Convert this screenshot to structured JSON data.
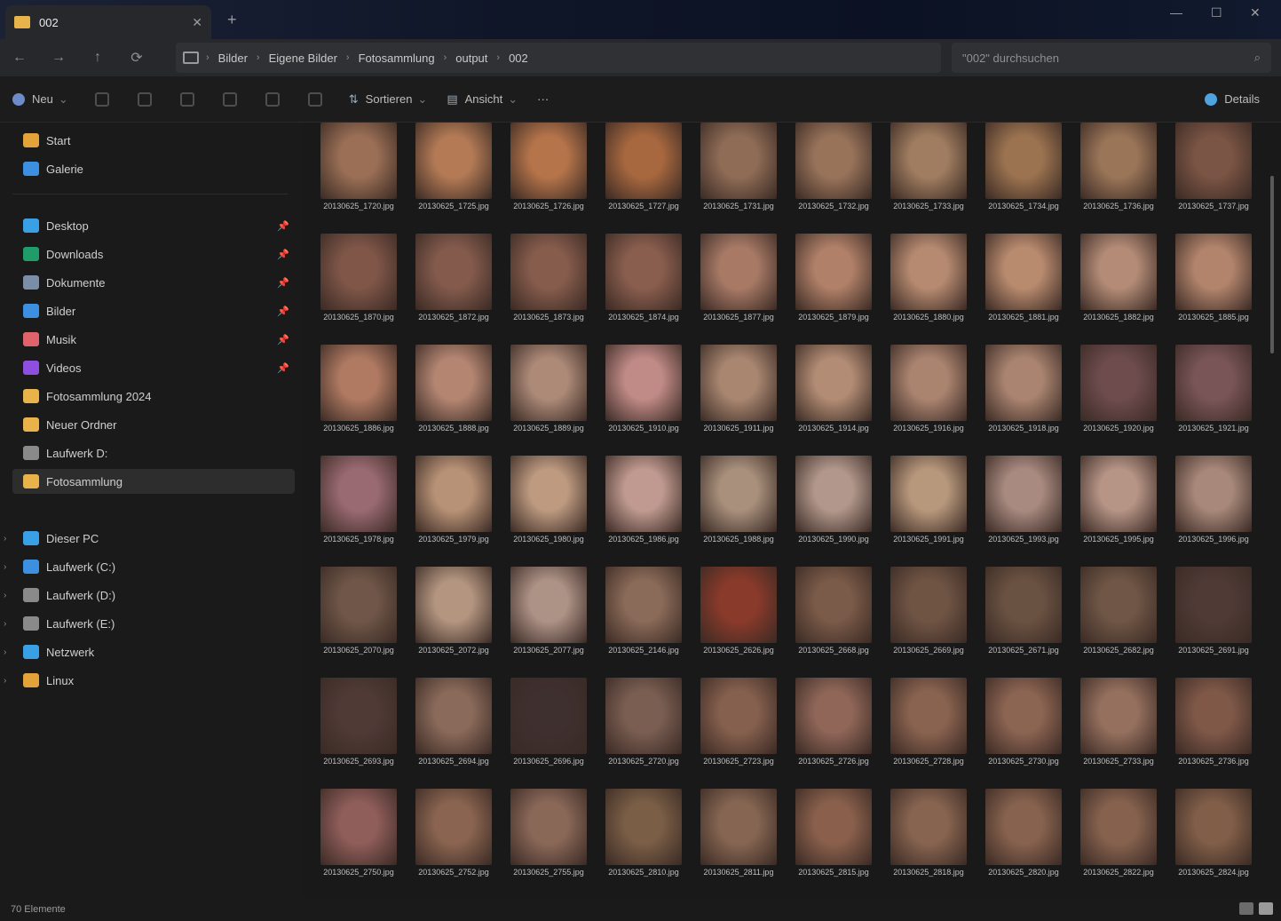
{
  "window": {
    "tab_title": "002"
  },
  "address": {
    "crumbs": [
      "Bilder",
      "Eigene Bilder",
      "Fotosammlung",
      "output",
      "002"
    ],
    "search_placeholder": "\"002\" durchsuchen"
  },
  "toolbar": {
    "new_label": "Neu",
    "sort_label": "Sortieren",
    "view_label": "Ansicht",
    "more_label": "···",
    "details_label": "Details"
  },
  "sidebar": {
    "quick": [
      {
        "label": "Start",
        "color": "#e3a33a"
      },
      {
        "label": "Galerie",
        "color": "#3d8fe0"
      }
    ],
    "pinned": [
      {
        "label": "Desktop",
        "color": "#3aa0e6"
      },
      {
        "label": "Downloads",
        "color": "#1f9c6a"
      },
      {
        "label": "Dokumente",
        "color": "#7a8ea8"
      },
      {
        "label": "Bilder",
        "color": "#3d8fe0"
      },
      {
        "label": "Musik",
        "color": "#e0636b"
      },
      {
        "label": "Videos",
        "color": "#8e4fe0"
      },
      {
        "label": "Fotosammlung 2024",
        "color": "#e8b34a"
      },
      {
        "label": "Neuer Ordner",
        "color": "#e8b34a"
      },
      {
        "label": "Laufwerk D:",
        "color": "#8a8a8a"
      },
      {
        "label": "Fotosammlung",
        "color": "#e8b34a"
      }
    ],
    "tree": [
      {
        "label": "Dieser PC",
        "color": "#3aa0e6"
      },
      {
        "label": "Laufwerk (C:)",
        "color": "#3d8fe0"
      },
      {
        "label": "Laufwerk (D:)",
        "color": "#8a8a8a"
      },
      {
        "label": "Laufwerk (E:)",
        "color": "#8a8a8a"
      },
      {
        "label": "Netzwerk",
        "color": "#3aa0e6"
      },
      {
        "label": "Linux",
        "color": "#e3a33a"
      }
    ]
  },
  "files": {
    "rows": [
      [
        "#9a6f55",
        "#b37a55",
        "#b5744a",
        "#a8683f",
        "#8f6c56",
        "#98735a",
        "#a07d60",
        "#9c7350",
        "#9a7558",
        "#7a5444"
      ],
      [
        "#7f5648",
        "#835a4c",
        "#865c4c",
        "#8a5e4e",
        "#a87a66",
        "#b08068",
        "#b68a70",
        "#b88a6e",
        "#b38b76",
        "#b2846c"
      ],
      [
        "#b07a62",
        "#b48672",
        "#ad8a78",
        "#c08a86",
        "#a88670",
        "#b28c74",
        "#ab8470",
        "#aa8470",
        "#6e4c4e",
        "#7a5558"
      ],
      [
        "#9a6a72",
        "#b89276",
        "#bd9a80",
        "#c09a90",
        "#a8907c",
        "#b2988c",
        "#b8987c",
        "#a88a80",
        "#b69486",
        "#a8887a"
      ],
      [
        "#6f5648",
        "#b39580",
        "#ad9286",
        "#8a6a58",
        "#8a3a2a",
        "#7a5a48",
        "#6f5444",
        "#6a5242",
        "#6f5646",
        "#4f3a36"
      ],
      [
        "#4f3a36",
        "#8a6a5a",
        "#3f3030",
        "#7a5e52",
        "#86604e",
        "#8f6658",
        "#8a6350",
        "#8c6452",
        "#95705e",
        "#7f5848"
      ],
      [
        "#8f5d5a",
        "#8a6450",
        "#8a6858",
        "#7a5e46",
        "#866652",
        "#8a604c",
        "#876450",
        "#87624e",
        "#86624e",
        "#805e48"
      ]
    ],
    "names": [
      [
        "20130625_1720.jpg",
        "20130625_1725.jpg",
        "20130625_1726.jpg",
        "20130625_1727.jpg",
        "20130625_1731.jpg",
        "20130625_1732.jpg",
        "20130625_1733.jpg",
        "20130625_1734.jpg",
        "20130625_1736.jpg",
        "20130625_1737.jpg"
      ],
      [
        "20130625_1870.jpg",
        "20130625_1872.jpg",
        "20130625_1873.jpg",
        "20130625_1874.jpg",
        "20130625_1877.jpg",
        "20130625_1879.jpg",
        "20130625_1880.jpg",
        "20130625_1881.jpg",
        "20130625_1882.jpg",
        "20130625_1885.jpg"
      ],
      [
        "20130625_1886.jpg",
        "20130625_1888.jpg",
        "20130625_1889.jpg",
        "20130625_1910.jpg",
        "20130625_1911.jpg",
        "20130625_1914.jpg",
        "20130625_1916.jpg",
        "20130625_1918.jpg",
        "20130625_1920.jpg",
        "20130625_1921.jpg"
      ],
      [
        "20130625_1978.jpg",
        "20130625_1979.jpg",
        "20130625_1980.jpg",
        "20130625_1986.jpg",
        "20130625_1988.jpg",
        "20130625_1990.jpg",
        "20130625_1991.jpg",
        "20130625_1993.jpg",
        "20130625_1995.jpg",
        "20130625_1996.jpg"
      ],
      [
        "20130625_2070.jpg",
        "20130625_2072.jpg",
        "20130625_2077.jpg",
        "20130625_2146.jpg",
        "20130625_2626.jpg",
        "20130625_2668.jpg",
        "20130625_2669.jpg",
        "20130625_2671.jpg",
        "20130625_2682.jpg",
        "20130625_2691.jpg"
      ],
      [
        "20130625_2693.jpg",
        "20130625_2694.jpg",
        "20130625_2696.jpg",
        "20130625_2720.jpg",
        "20130625_2723.jpg",
        "20130625_2726.jpg",
        "20130625_2728.jpg",
        "20130625_2730.jpg",
        "20130625_2733.jpg",
        "20130625_2736.jpg"
      ],
      [
        "20130625_2750.jpg",
        "20130625_2752.jpg",
        "20130625_2755.jpg",
        "20130625_2810.jpg",
        "20130625_2811.jpg",
        "20130625_2815.jpg",
        "20130625_2818.jpg",
        "20130625_2820.jpg",
        "20130625_2822.jpg",
        "20130625_2824.jpg"
      ]
    ]
  },
  "status": {
    "count": "70 Elemente"
  }
}
